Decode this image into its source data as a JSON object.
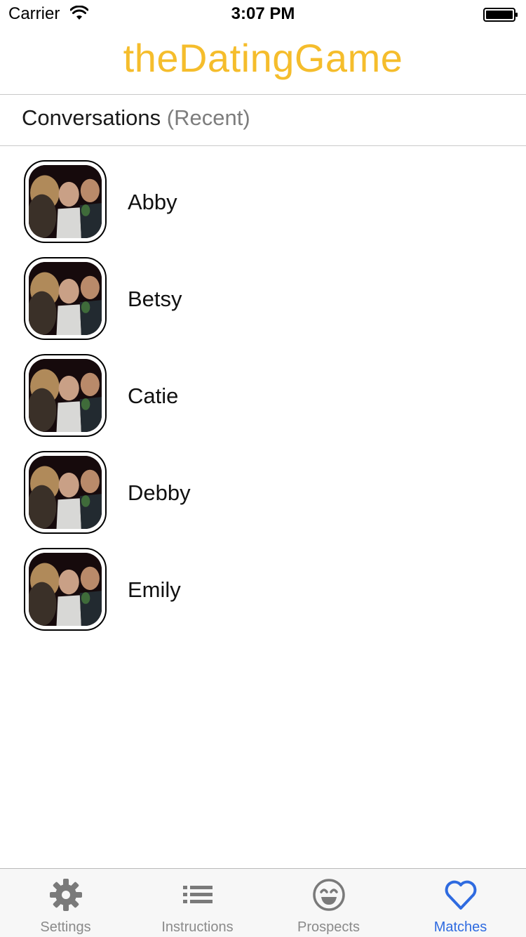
{
  "status_bar": {
    "carrier": "Carrier",
    "time": "3:07 PM"
  },
  "app": {
    "title": "theDatingGame",
    "accent_color": "#f5bd2c"
  },
  "section": {
    "title": "Conversations",
    "subtitle": "(Recent)"
  },
  "conversations": [
    {
      "name": "Abby"
    },
    {
      "name": "Betsy"
    },
    {
      "name": "Catie"
    },
    {
      "name": "Debby"
    },
    {
      "name": "Emily"
    }
  ],
  "tabs": [
    {
      "label": "Settings",
      "icon": "gear-icon",
      "active": false
    },
    {
      "label": "Instructions",
      "icon": "list-icon",
      "active": false
    },
    {
      "label": "Prospects",
      "icon": "smiley-icon",
      "active": false
    },
    {
      "label": "Matches",
      "icon": "heart-icon",
      "active": true
    }
  ],
  "colors": {
    "tab_active": "#2f6be0",
    "tab_inactive": "#8a8a8a"
  }
}
